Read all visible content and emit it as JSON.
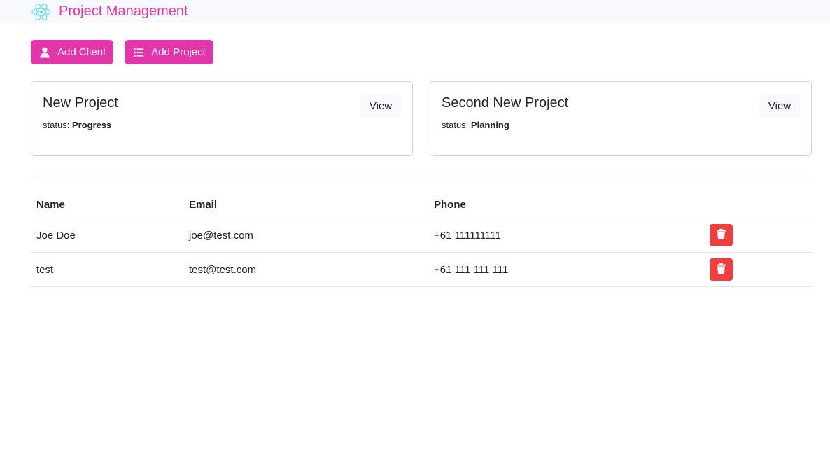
{
  "navbar": {
    "brand_text": "Project Management",
    "logo_icon": "react-logo-icon",
    "brand_color": "#e535ab"
  },
  "actions": {
    "add_client_label": "Add Client",
    "add_client_icon": "user-icon",
    "add_project_label": "Add Project",
    "add_project_icon": "list-icon",
    "button_color": "#e535ab"
  },
  "projects": [
    {
      "name": "New Project",
      "status_label": "status:",
      "status": "Progress",
      "view_label": "View"
    },
    {
      "name": "Second New Project",
      "status_label": "status:",
      "status": "Planning",
      "view_label": "View"
    }
  ],
  "clients_table": {
    "headers": [
      "Name",
      "Email",
      "Phone",
      ""
    ],
    "rows": [
      {
        "name": "Joe Doe",
        "email": "joe@test.com",
        "phone": "+61 111111111",
        "delete_icon": "trash-icon"
      },
      {
        "name": "test",
        "email": "test@test.com",
        "phone": "+61 111 111 111",
        "delete_icon": "trash-icon"
      }
    ],
    "delete_color": "#ef3e3e"
  }
}
